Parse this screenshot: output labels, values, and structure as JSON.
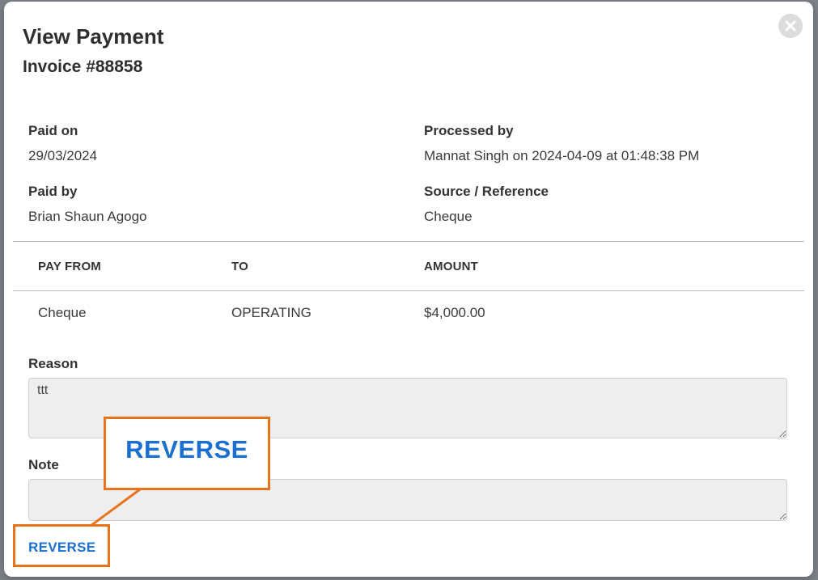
{
  "modal": {
    "title": "View Payment",
    "subtitle": "Invoice #88858",
    "close_icon": "close-x-icon"
  },
  "details": {
    "paid_on_label": "Paid on",
    "paid_on_value": "29/03/2024",
    "processed_by_label": "Processed by",
    "processed_by_value": "Mannat Singh on 2024-04-09 at 01:48:38 PM",
    "paid_by_label": "Paid by",
    "paid_by_value": "Brian Shaun Agogo",
    "source_label": "Source / Reference",
    "source_value": "Cheque"
  },
  "table": {
    "headers": [
      "PAY FROM",
      "TO",
      "AMOUNT"
    ],
    "rows": [
      [
        "Cheque",
        "OPERATING",
        "$4,000.00"
      ]
    ]
  },
  "form": {
    "reason_label": "Reason",
    "reason_value": "ttt",
    "note_label": "Note",
    "note_value": ""
  },
  "actions": {
    "reverse_label": "REVERSE"
  },
  "annotation": {
    "zoom_label": "REVERSE",
    "highlight_color": "#e8731e"
  },
  "colors": {
    "accent": "#1a6fd1",
    "highlight": "#e8731e"
  }
}
